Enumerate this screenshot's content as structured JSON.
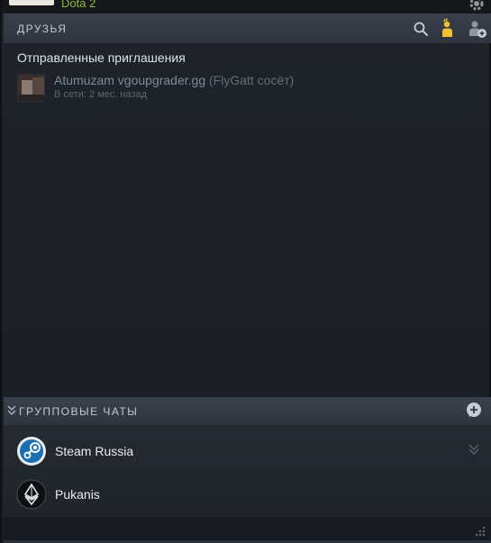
{
  "top_strip": {
    "game": "Dota 2",
    "icons": {
      "settings": "gear-icon"
    }
  },
  "friends": {
    "header_title": "ДРУЗЬЯ",
    "icons": {
      "search": "search-icon",
      "add_friend": "add-friend-icon",
      "manage_friends": "friends-add-icon"
    },
    "sent_invites_label": "Отправленные приглашения",
    "invites": [
      {
        "name": "Atumuzam vgoupgrader.gg",
        "nickname": "(FlyGatt cосёт)",
        "status": "В сети: 2 мес. назад"
      }
    ]
  },
  "group_chats": {
    "header_title": "ГРУППОВЫЕ ЧАТЫ",
    "icons": {
      "collapse": "double-chevron-down-icon",
      "create": "add-chat-icon"
    },
    "items": [
      {
        "name": "Steam Russia",
        "icon": "steam-logo-icon"
      },
      {
        "name": "Pukanis",
        "icon": "ethereum-logo-icon"
      }
    ]
  },
  "colors": {
    "header_bg": "#353b45",
    "accent_yellow": "#f0c231",
    "game_green": "#8fb93b",
    "steam_blue": "#1a9fff"
  }
}
